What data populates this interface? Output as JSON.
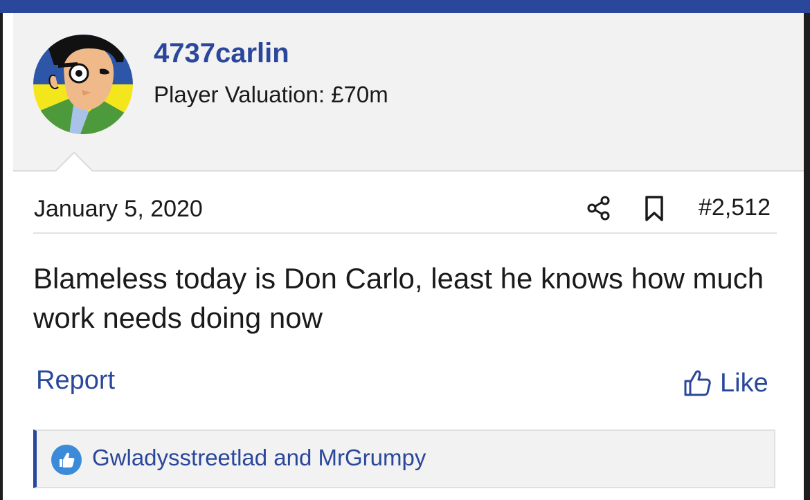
{
  "post": {
    "username": "4737carlin",
    "valuation": "Player Valuation: £70m",
    "date": "January 5, 2020",
    "number": "#2,512",
    "body": "Blameless today is Don Carlo, least he knows how much work needs doing now"
  },
  "actions": {
    "report_label": "Report",
    "like_label": "Like"
  },
  "likes": {
    "text": "Gwladysstreetlad and MrGrumpy"
  },
  "icons": {
    "share": "share-icon",
    "bookmark": "bookmark-icon",
    "like": "thumbs-up-icon",
    "likes_badge": "thumbs-up-badge-icon"
  },
  "colors": {
    "accent": "#2a479b",
    "like_badge": "#3b8bd8"
  }
}
